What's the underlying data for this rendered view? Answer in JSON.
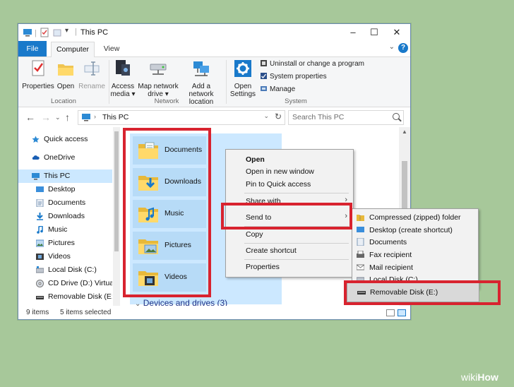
{
  "window": {
    "title": "This PC",
    "tabs": [
      "File",
      "Computer",
      "View"
    ],
    "help": "?"
  },
  "ribbon": {
    "location": {
      "label": "Location",
      "buttons": [
        {
          "label": "Properties"
        },
        {
          "label": "Open"
        },
        {
          "label": "Rename"
        }
      ]
    },
    "network": {
      "label": "Network",
      "buttons": [
        {
          "line1": "Access",
          "line2": "media"
        },
        {
          "line1": "Map network",
          "line2": "drive"
        },
        {
          "line1": "Add a network",
          "line2": "location"
        }
      ]
    },
    "system": {
      "label": "System",
      "open_settings": {
        "line1": "Open",
        "line2": "Settings"
      },
      "items": [
        "Uninstall or change a program",
        "System properties",
        "Manage"
      ]
    }
  },
  "address": {
    "path": "This PC",
    "search_placeholder": "Search This PC"
  },
  "nav": {
    "items": [
      {
        "label": "Quick access",
        "icon": "star-icon"
      },
      {
        "label": "OneDrive",
        "icon": "cloud-icon"
      },
      {
        "label": "This PC",
        "icon": "computer-icon",
        "selected": true
      },
      {
        "label": "Desktop",
        "icon": "desktop-icon"
      },
      {
        "label": "Documents",
        "icon": "documents-icon"
      },
      {
        "label": "Downloads",
        "icon": "downloads-icon"
      },
      {
        "label": "Music",
        "icon": "music-icon"
      },
      {
        "label": "Pictures",
        "icon": "pictures-icon"
      },
      {
        "label": "Videos",
        "icon": "videos-icon"
      },
      {
        "label": "Local Disk (C:)",
        "icon": "drive-icon"
      },
      {
        "label": "CD Drive (D:) VirtualB",
        "icon": "cd-icon"
      },
      {
        "label": "Removable Disk (E:)",
        "icon": "usb-icon"
      }
    ]
  },
  "folders": [
    {
      "label": "Documents",
      "icon": "documents-folder-icon"
    },
    {
      "label": "Downloads",
      "icon": "downloads-folder-icon"
    },
    {
      "label": "Music",
      "icon": "music-folder-icon"
    },
    {
      "label": "Pictures",
      "icon": "pictures-folder-icon"
    },
    {
      "label": "Videos",
      "icon": "videos-folder-icon"
    }
  ],
  "devices_header": "Devices and drives (3)",
  "status": {
    "count": "9 items",
    "selected": "5 items selected"
  },
  "context_menu": {
    "items": [
      "Open",
      "Open in new window",
      "Pin to Quick access",
      "Share with",
      "Send to",
      "Copy",
      "Create shortcut",
      "Properties"
    ]
  },
  "send_to": {
    "items": [
      "Compressed (zipped) folder",
      "Desktop (create shortcut)",
      "Documents",
      "Fax recipient",
      "Mail recipient",
      "Local Disk (C:)",
      "Removable Disk (E:)"
    ]
  },
  "watermark": {
    "wiki": "wiki",
    "how": "How"
  },
  "colors": {
    "accent": "#1979ca",
    "highlight": "#d8232f",
    "selection": "#cce8ff",
    "background": "#a7c89a"
  }
}
